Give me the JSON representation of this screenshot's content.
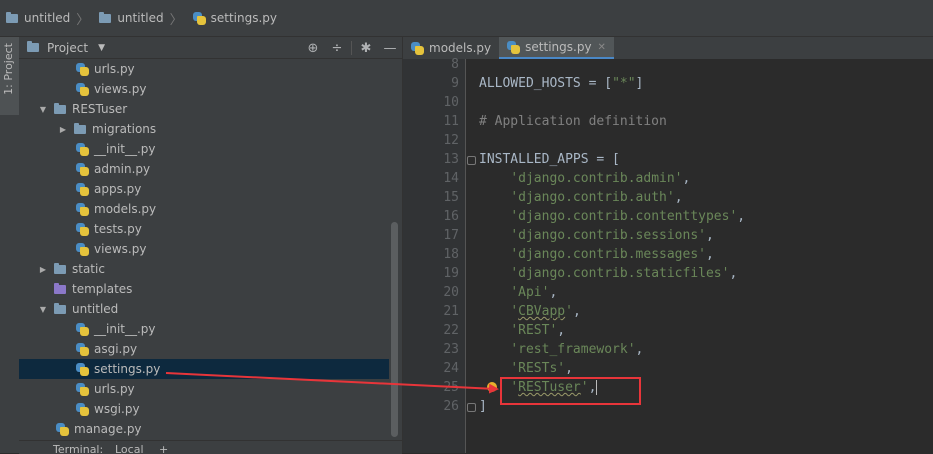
{
  "breadcrumb": {
    "root": "untitled",
    "folder": "untitled",
    "file": "settings.py"
  },
  "sidebar_strip": {
    "label": "1: Project"
  },
  "project_panel": {
    "title": "Project",
    "tree": [
      {
        "name": "urls.py",
        "indent": 3,
        "kind": "py"
      },
      {
        "name": "views.py",
        "indent": 3,
        "kind": "py"
      },
      {
        "name": "RESTuser",
        "indent": 1,
        "kind": "folder",
        "arrow": "open"
      },
      {
        "name": "migrations",
        "indent": 2,
        "kind": "folder",
        "arrow": "closed"
      },
      {
        "name": "__init__.py",
        "indent": 3,
        "kind": "py"
      },
      {
        "name": "admin.py",
        "indent": 3,
        "kind": "py"
      },
      {
        "name": "apps.py",
        "indent": 3,
        "kind": "py"
      },
      {
        "name": "models.py",
        "indent": 3,
        "kind": "py"
      },
      {
        "name": "tests.py",
        "indent": 3,
        "kind": "py"
      },
      {
        "name": "views.py",
        "indent": 3,
        "kind": "py"
      },
      {
        "name": "static",
        "indent": 1,
        "kind": "folder",
        "arrow": "closed"
      },
      {
        "name": "templates",
        "indent": 1,
        "kind": "folder-purple",
        "arrow": "none"
      },
      {
        "name": "untitled",
        "indent": 1,
        "kind": "folder",
        "arrow": "open"
      },
      {
        "name": "__init__.py",
        "indent": 3,
        "kind": "py"
      },
      {
        "name": "asgi.py",
        "indent": 3,
        "kind": "py"
      },
      {
        "name": "settings.py",
        "indent": 3,
        "kind": "py",
        "selected": true
      },
      {
        "name": "urls.py",
        "indent": 3,
        "kind": "py"
      },
      {
        "name": "wsgi.py",
        "indent": 3,
        "kind": "py"
      },
      {
        "name": "manage.py",
        "indent": 2,
        "kind": "py"
      }
    ]
  },
  "bottom_bar": {
    "terminal": "Terminal:",
    "local": "Local",
    "plus": "+"
  },
  "editor": {
    "tabs": [
      {
        "label": "models.py",
        "active": false
      },
      {
        "label": "settings.py",
        "active": true
      }
    ],
    "lines": [
      {
        "n": "8",
        "text": ""
      },
      {
        "n": "9",
        "text": "ALLOWED_HOSTS = [\"*\"]"
      },
      {
        "n": "10",
        "text": ""
      },
      {
        "n": "11",
        "text": "# Application definition"
      },
      {
        "n": "12",
        "text": ""
      },
      {
        "n": "13",
        "text": "INSTALLED_APPS = ["
      },
      {
        "n": "14",
        "text": "    'django.contrib.admin',"
      },
      {
        "n": "15",
        "text": "    'django.contrib.auth',"
      },
      {
        "n": "16",
        "text": "    'django.contrib.contenttypes',"
      },
      {
        "n": "17",
        "text": "    'django.contrib.sessions',"
      },
      {
        "n": "18",
        "text": "    'django.contrib.messages',"
      },
      {
        "n": "19",
        "text": "    'django.contrib.staticfiles',"
      },
      {
        "n": "20",
        "text": "    'Api',"
      },
      {
        "n": "21",
        "text": "    'CBVapp',"
      },
      {
        "n": "22",
        "text": "    'REST',"
      },
      {
        "n": "23",
        "text": "    'rest_framework',"
      },
      {
        "n": "24",
        "text": "    'RESTs',"
      },
      {
        "n": "25",
        "text": "    'RESTuser',"
      },
      {
        "n": "26",
        "text": "]"
      }
    ]
  },
  "annotation": {
    "color": "#e8353a"
  }
}
